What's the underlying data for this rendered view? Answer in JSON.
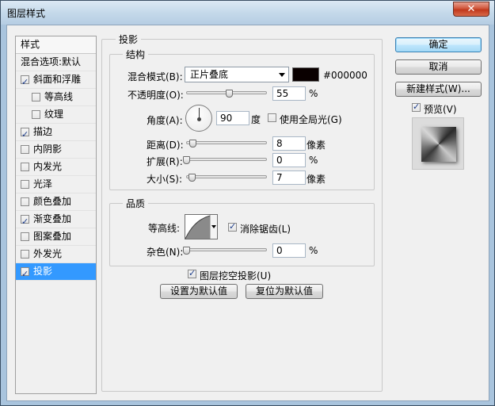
{
  "window": {
    "title": "图层样式",
    "close_label": "✕"
  },
  "stylelist": {
    "header": "样式",
    "blend_options": "混合选项:默认",
    "items": [
      {
        "label": "斜面和浮雕",
        "checked": true
      },
      {
        "label": "等高线",
        "checked": false
      },
      {
        "label": "纹理",
        "checked": false
      },
      {
        "label": "描边",
        "checked": true
      },
      {
        "label": "内阴影",
        "checked": false
      },
      {
        "label": "内发光",
        "checked": false
      },
      {
        "label": "光泽",
        "checked": false
      },
      {
        "label": "颜色叠加",
        "checked": false
      },
      {
        "label": "渐变叠加",
        "checked": true
      },
      {
        "label": "图案叠加",
        "checked": false
      },
      {
        "label": "外发光",
        "checked": false
      },
      {
        "label": "投影",
        "checked": true,
        "selected": true
      }
    ]
  },
  "shadow": {
    "title": "投影",
    "structure": {
      "title": "结构",
      "blend_mode_label": "混合模式(B):",
      "blend_mode_value": "正片叠底",
      "color_hex": "#000000",
      "opacity_label": "不透明度(O):",
      "opacity_value": "55",
      "opacity_unit": "%",
      "angle_label": "角度(A):",
      "angle_value": "90",
      "angle_unit": "度",
      "global_light_label": "使用全局光(G)",
      "global_light_checked": false,
      "distance_label": "距离(D):",
      "distance_value": "8",
      "distance_unit": "像素",
      "spread_label": "扩展(R):",
      "spread_value": "0",
      "spread_unit": "%",
      "size_label": "大小(S):",
      "size_value": "7",
      "size_unit": "像素"
    },
    "quality": {
      "title": "品质",
      "contour_label": "等高线:",
      "antialias_label": "消除锯齿(L)",
      "antialias_checked": true,
      "noise_label": "杂色(N):",
      "noise_value": "0",
      "noise_unit": "%"
    },
    "knockout_label": "图层挖空投影(U)",
    "knockout_checked": true,
    "make_default_label": "设置为默认值",
    "reset_default_label": "复位为默认值"
  },
  "buttons": {
    "ok": "确定",
    "cancel": "取消",
    "new_style": "新建样式(W)...",
    "preview_label": "预览(V)",
    "preview_checked": true
  }
}
